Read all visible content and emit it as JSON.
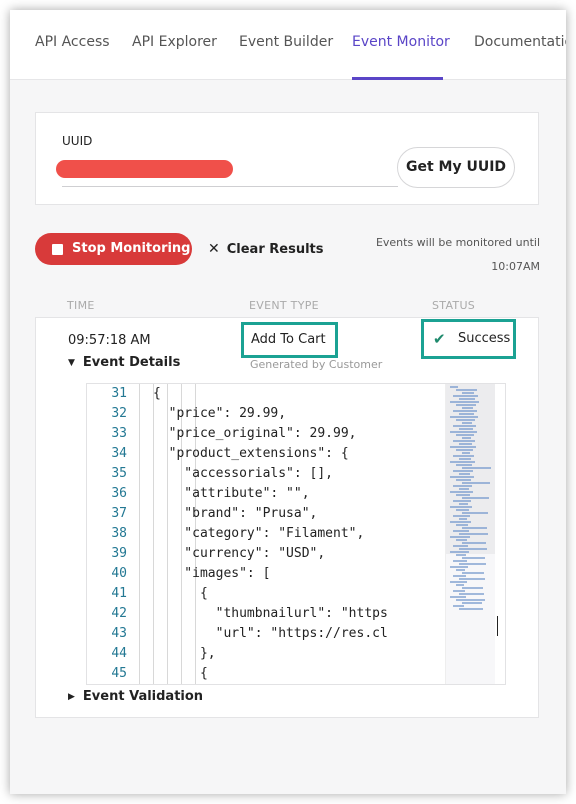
{
  "nav": {
    "tabs": [
      {
        "label": "API Access",
        "active": false
      },
      {
        "label": "API Explorer",
        "active": false
      },
      {
        "label": "Event Builder",
        "active": false
      },
      {
        "label": "Event Monitor",
        "active": true
      },
      {
        "label": "Documentation",
        "active": false
      }
    ]
  },
  "uuid_card": {
    "label": "UUID",
    "button_label": "Get My UUID"
  },
  "controls": {
    "stop_label": "Stop Monitoring",
    "clear_label": "Clear Results",
    "note_line1": "Events will be monitored until",
    "note_line2": "10:07AM"
  },
  "columns": {
    "time": "TIME",
    "event_type": "EVENT TYPE",
    "status": "STATUS"
  },
  "event": {
    "time": "09:57:18 AM",
    "type": "Add To Cart",
    "generated_by": "Generated by Customer",
    "status": "Success",
    "details_label": "Event Details",
    "validation_label": "Event Validation"
  },
  "code_lines": [
    {
      "num": "31",
      "text": "{"
    },
    {
      "num": "32",
      "text": "  \"price\": 29.99,"
    },
    {
      "num": "33",
      "text": "  \"price_original\": 29.99,"
    },
    {
      "num": "34",
      "text": "  \"product_extensions\": {"
    },
    {
      "num": "35",
      "text": "    \"accessorials\": [],"
    },
    {
      "num": "36",
      "text": "    \"attribute\": \"\","
    },
    {
      "num": "37",
      "text": "    \"brand\": \"Prusa\","
    },
    {
      "num": "38",
      "text": "    \"category\": \"Filament\","
    },
    {
      "num": "39",
      "text": "    \"currency\": \"USD\","
    },
    {
      "num": "40",
      "text": "    \"images\": ["
    },
    {
      "num": "41",
      "text": "      {"
    },
    {
      "num": "42",
      "text": "        \"thumbnailurl\": \"https"
    },
    {
      "num": "43",
      "text": "        \"url\": \"https://res.cl"
    },
    {
      "num": "44",
      "text": "      },"
    },
    {
      "num": "45",
      "text": "      {"
    }
  ],
  "colors": {
    "accent": "#5a45c7",
    "stop_button": "#d83a3a",
    "highlight_border": "#1ba293",
    "success_check": "#1f8a6d",
    "redaction": "#f0504a"
  },
  "icons": {
    "stop": "stop-square-icon",
    "clear": "close-icon",
    "success": "check-icon",
    "expanded": "caret-down-icon",
    "collapsed": "caret-right-icon"
  }
}
